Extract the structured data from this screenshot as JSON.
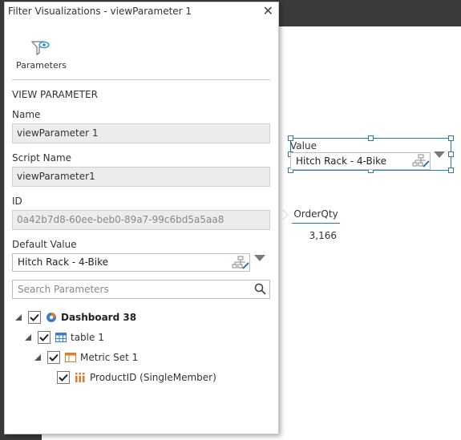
{
  "colors": {
    "accent": "#2a7ab0",
    "background_dark": "#3a3a3a",
    "funnel_icon": "#2a8fc0",
    "table_icon": "#3a7fc4",
    "metric_icon": "#e07a2e",
    "member_icon": "#e07a2e"
  },
  "dialog": {
    "title": "Filter Visualizations - viewParameter 1",
    "close_glyph": "✕",
    "toolbar": {
      "parameters_label": "Parameters",
      "parameters_icon": "funnel-eye-icon"
    },
    "section_heading": "VIEW PARAMETER",
    "fields": {
      "name_label": "Name",
      "name_value": "viewParameter 1",
      "script_name_label": "Script Name",
      "script_name_value": "viewParameter1",
      "id_label": "ID",
      "id_value": "0a42b7d8-60ee-beb0-89a7-99c6bd5a5aa8",
      "default_value_label": "Default Value",
      "default_value": "Hitch Rack - 4-Bike"
    },
    "search": {
      "placeholder": "Search Parameters"
    },
    "tree": [
      {
        "label": "Dashboard 38",
        "checked": true,
        "icon": "dashboard-icon",
        "bold": true
      },
      {
        "label": "table 1",
        "checked": true,
        "icon": "table-icon"
      },
      {
        "label": "Metric Set 1",
        "checked": true,
        "icon": "metric-set-icon"
      },
      {
        "label": "ProductID (SingleMember)",
        "checked": true,
        "icon": "single-member-icon"
      }
    ]
  },
  "canvas": {
    "parameter_control": {
      "label": "Value",
      "value": "Hitch Rack - 4-Bike"
    },
    "table": {
      "column_header": "OrderQty",
      "value": "3,166"
    }
  }
}
